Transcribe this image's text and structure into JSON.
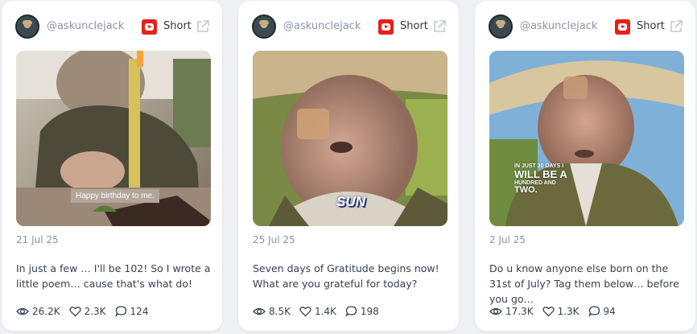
{
  "posts": [
    {
      "handle": "@askunclejack",
      "type": "Short",
      "date": "21 Jul 25",
      "caption": "In just a few … I'll be 102! So I wrote a little poem… cause that's what do!",
      "views": "26.2K",
      "likes": "2.3K",
      "comments": "124",
      "overlay": "Happy birthday to me."
    },
    {
      "handle": "@askunclejack",
      "type": "Short",
      "date": "25 Jul 25",
      "caption": "Seven days of Gratitude begins now! What are you grateful for today?",
      "views": "8.5K",
      "likes": "1.4K",
      "comments": "198",
      "overlay": "SUN"
    },
    {
      "handle": "@askunclejack",
      "type": "Short",
      "date": "2 Jul 25",
      "caption": "Do u know anyone else born on the 31st of July? Tag them below… before you go…",
      "views": "17.3K",
      "likes": "1.3K",
      "comments": "94",
      "overlay_line1": "IN JUST 30 DAYS I",
      "overlay_line2": "WILL BE A",
      "overlay_line3": "HUNDRED AND",
      "overlay_line4": "TWO."
    }
  ],
  "colors": {
    "youtube_red": "#e62117",
    "muted_text": "#8b93a7",
    "body_text": "#3a4050"
  },
  "icons": [
    "avatar",
    "youtube-icon",
    "external-link-icon",
    "eye-icon",
    "heart-icon",
    "comment-icon"
  ]
}
